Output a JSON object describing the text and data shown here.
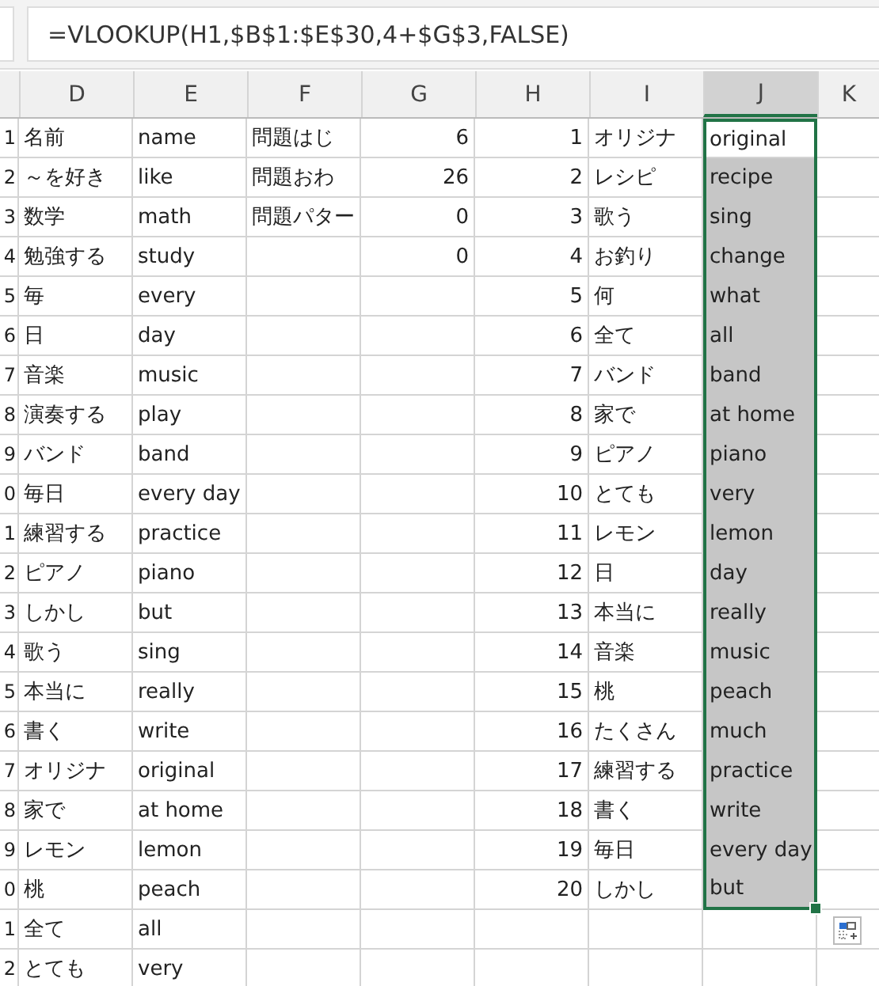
{
  "formula_bar": {
    "formula": "=VLOOKUP(H1,$B$1:$E$30,4+$G$3,FALSE)"
  },
  "columns": [
    {
      "label": "D",
      "selected": false
    },
    {
      "label": "E",
      "selected": false
    },
    {
      "label": "F",
      "selected": false
    },
    {
      "label": "G",
      "selected": false
    },
    {
      "label": "H",
      "selected": false
    },
    {
      "label": "I",
      "selected": false
    },
    {
      "label": "J",
      "selected": true
    },
    {
      "label": "K",
      "selected": false
    }
  ],
  "rows": [
    {
      "c": "1",
      "d": "名前",
      "e": "name",
      "f": "問題はじ",
      "g": "6",
      "h": "1",
      "i": "オリジナ",
      "j": {
        "text": "original",
        "selected": true,
        "active": true
      }
    },
    {
      "c": "2",
      "d": "～を好き",
      "e": "like",
      "f": "問題おわ",
      "g": "26",
      "h": "2",
      "i": "レシピ",
      "j": {
        "text": "recipe",
        "selected": true,
        "active": false
      }
    },
    {
      "c": "3",
      "d": "数学",
      "e": "math",
      "f": "問題パター",
      "g": "0",
      "h": "3",
      "i": "歌う",
      "j": {
        "text": "sing",
        "selected": true,
        "active": false
      }
    },
    {
      "c": "4",
      "d": "勉強する",
      "e": "study",
      "g": "0",
      "h": "4",
      "i": "お釣り",
      "j": {
        "text": "change",
        "selected": true,
        "active": false
      }
    },
    {
      "c": "5",
      "d": "毎",
      "e": "every",
      "h": "5",
      "i": "何",
      "j": {
        "text": "what",
        "selected": true,
        "active": false
      }
    },
    {
      "c": "6",
      "d": "日",
      "e": "day",
      "h": "6",
      "i": "全て",
      "j": {
        "text": "all",
        "selected": true,
        "active": false
      }
    },
    {
      "c": "7",
      "d": "音楽",
      "e": "music",
      "h": "7",
      "i": "バンド",
      "j": {
        "text": "band",
        "selected": true,
        "active": false
      }
    },
    {
      "c": "8",
      "d": "演奏する",
      "e": "play",
      "h": "8",
      "i": "家で",
      "j": {
        "text": "at home",
        "selected": true,
        "active": false
      }
    },
    {
      "c": "9",
      "d": "バンド",
      "e": "band",
      "h": "9",
      "i": "ピアノ",
      "j": {
        "text": "piano",
        "selected": true,
        "active": false
      }
    },
    {
      "c": "0",
      "d": "毎日",
      "e": "every day",
      "h": "10",
      "i": "とても",
      "j": {
        "text": "very",
        "selected": true,
        "active": false
      }
    },
    {
      "c": "1",
      "d": "練習する",
      "e": "practice",
      "h": "11",
      "i": "レモン",
      "j": {
        "text": "lemon",
        "selected": true,
        "active": false
      }
    },
    {
      "c": "2",
      "d": "ピアノ",
      "e": "piano",
      "h": "12",
      "i": "日",
      "j": {
        "text": "day",
        "selected": true,
        "active": false
      }
    },
    {
      "c": "3",
      "d": "しかし",
      "e": "but",
      "h": "13",
      "i": "本当に",
      "j": {
        "text": "really",
        "selected": true,
        "active": false
      }
    },
    {
      "c": "4",
      "d": "歌う",
      "e": "sing",
      "h": "14",
      "i": "音楽",
      "j": {
        "text": "music",
        "selected": true,
        "active": false
      }
    },
    {
      "c": "5",
      "d": "本当に",
      "e": "really",
      "h": "15",
      "i": "桃",
      "j": {
        "text": "peach",
        "selected": true,
        "active": false
      }
    },
    {
      "c": "6",
      "d": "書く",
      "e": "write",
      "h": "16",
      "i": "たくさん",
      "j": {
        "text": "much",
        "selected": true,
        "active": false
      }
    },
    {
      "c": "7",
      "d": "オリジナ",
      "e": "original",
      "h": "17",
      "i": "練習する",
      "j": {
        "text": "practice",
        "selected": true,
        "active": false
      }
    },
    {
      "c": "8",
      "d": "家で",
      "e": "at home",
      "h": "18",
      "i": "書く",
      "j": {
        "text": "write",
        "selected": true,
        "active": false
      }
    },
    {
      "c": "9",
      "d": "レモン",
      "e": "lemon",
      "h": "19",
      "i": "毎日",
      "j": {
        "text": "every day",
        "selected": true,
        "active": false
      }
    },
    {
      "c": "0",
      "d": "桃",
      "e": "peach",
      "h": "20",
      "i": "しかし",
      "j": {
        "text": "but",
        "selected": true,
        "active": false
      }
    },
    {
      "c": "1",
      "d": "全て",
      "e": "all"
    },
    {
      "c": "2",
      "d": "とても",
      "e": "very"
    }
  ]
}
